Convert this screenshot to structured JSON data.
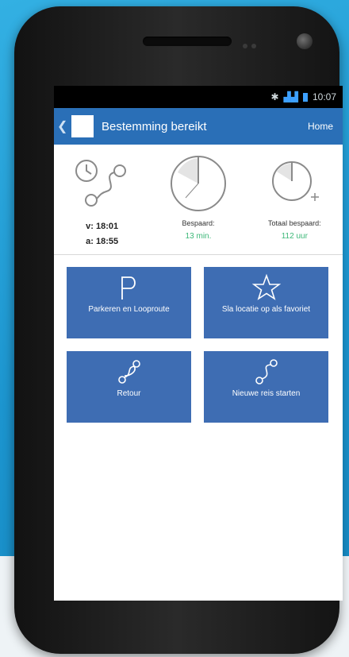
{
  "status_bar": {
    "time": "10:07"
  },
  "app_bar": {
    "title": "Bestemming bereikt",
    "back_glyph": "❮",
    "home_label": "Home"
  },
  "stats": {
    "times": {
      "departure": "v: 18:01",
      "arrival": "a: 18:55"
    },
    "saved": {
      "label": "Bespaard:",
      "value": "13 min."
    },
    "total_saved": {
      "label": "Totaal bespaard:",
      "value": "112 uur"
    }
  },
  "actions": [
    {
      "label": "Parkeren en Looproute",
      "icon": "parking-icon"
    },
    {
      "label": "Sla locatie op als favoriet",
      "icon": "star-icon"
    },
    {
      "label": "Retour",
      "icon": "return-route-icon"
    },
    {
      "label": "Nieuwe reis starten",
      "icon": "new-route-icon"
    }
  ],
  "colors": {
    "app_bar": "#2a6fb7",
    "tile": "#3e6db3",
    "accent_green": "#3cb878"
  }
}
